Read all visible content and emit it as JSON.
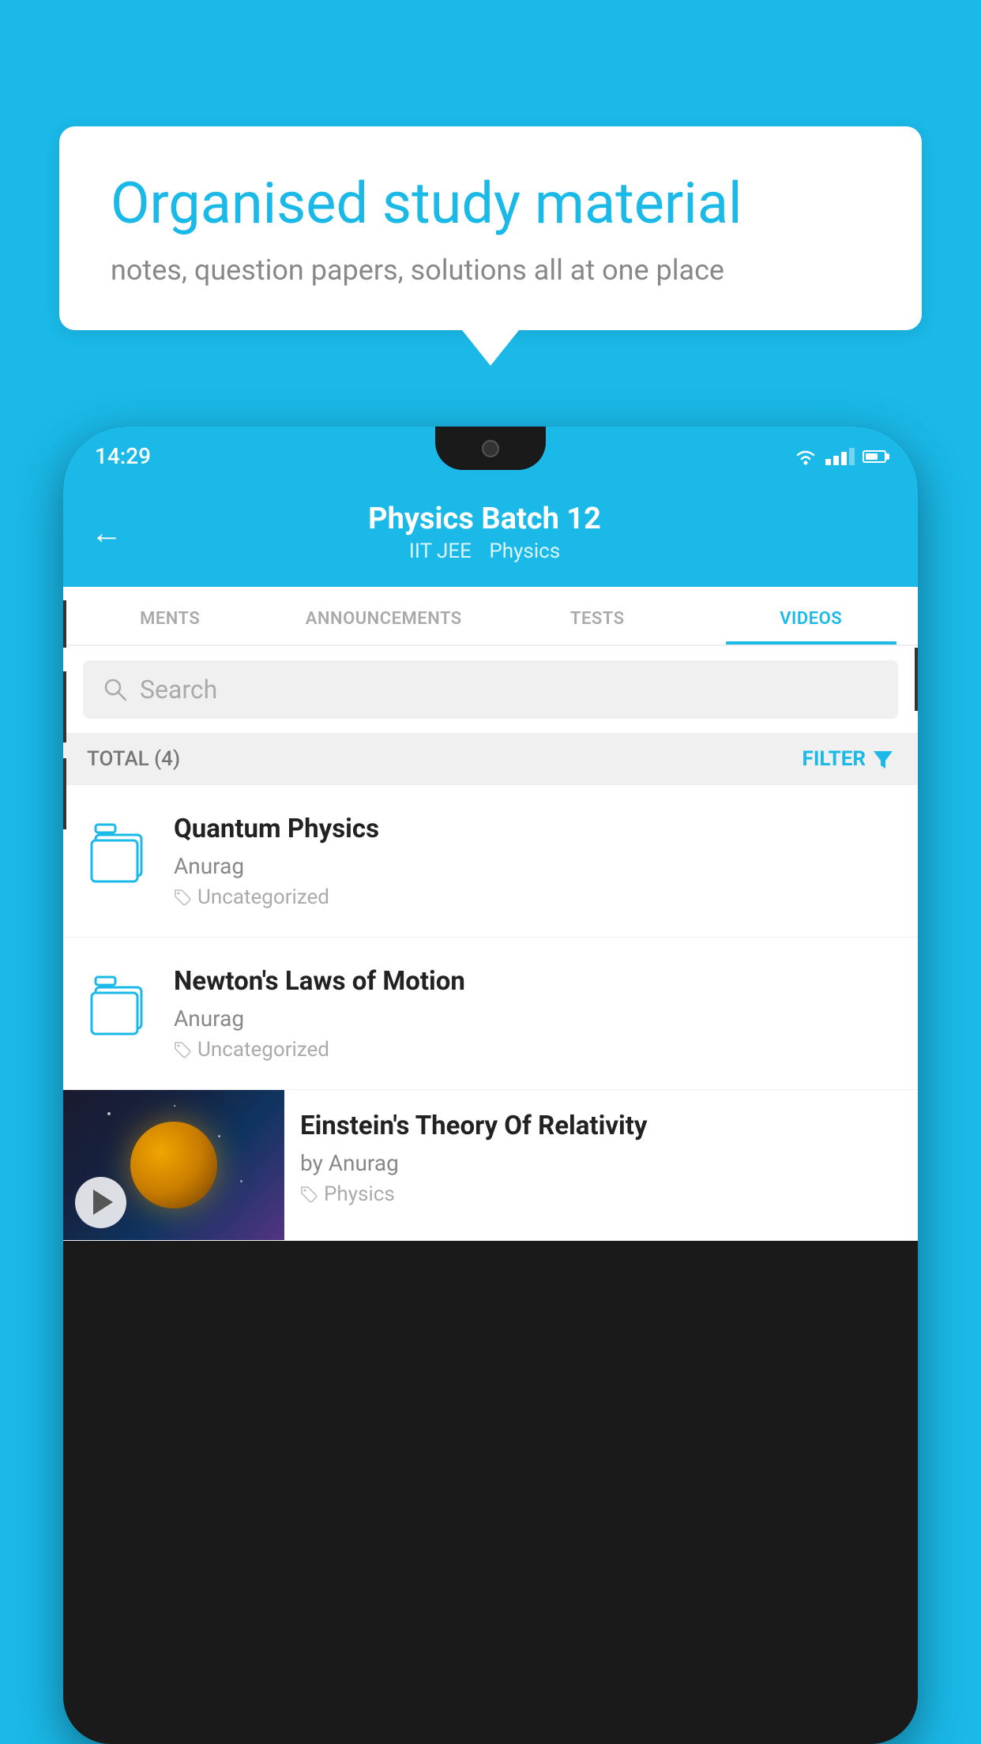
{
  "background_color": "#1ab9e8",
  "speech_bubble": {
    "headline": "Organised study material",
    "subtext": "notes, question papers, solutions all at one place"
  },
  "phone": {
    "status_bar": {
      "time": "14:29"
    },
    "header": {
      "title": "Physics Batch 12",
      "subtitle_part1": "IIT JEE",
      "subtitle_part2": "Physics",
      "back_label": "←"
    },
    "tabs": [
      {
        "label": "MENTS",
        "active": false
      },
      {
        "label": "ANNOUNCEMENTS",
        "active": false
      },
      {
        "label": "TESTS",
        "active": false
      },
      {
        "label": "VIDEOS",
        "active": true
      }
    ],
    "search": {
      "placeholder": "Search"
    },
    "list_header": {
      "total_label": "TOTAL (4)",
      "filter_label": "FILTER"
    },
    "videos": [
      {
        "title": "Quantum Physics",
        "author": "Anurag",
        "tag": "Uncategorized",
        "has_thumbnail": false
      },
      {
        "title": "Newton's Laws of Motion",
        "author": "Anurag",
        "tag": "Uncategorized",
        "has_thumbnail": false
      },
      {
        "title": "Einstein's Theory Of Relativity",
        "author": "by Anurag",
        "tag": "Physics",
        "has_thumbnail": true
      }
    ]
  }
}
